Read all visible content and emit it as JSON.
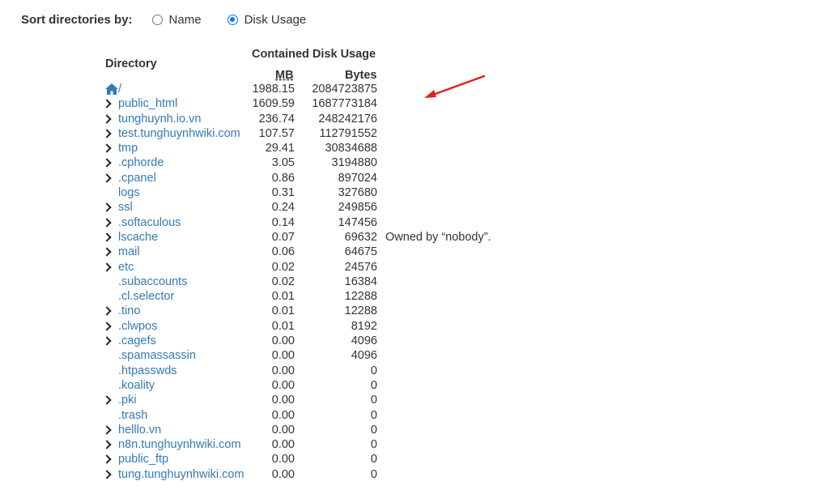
{
  "sort": {
    "label": "Sort directories by:",
    "options": [
      {
        "label": "Name",
        "checked": false
      },
      {
        "label": "Disk Usage",
        "checked": true
      }
    ]
  },
  "table": {
    "header_directory": "Directory",
    "header_contained": "Contained Disk Usage",
    "header_mb": "MB",
    "header_bytes": "Bytes"
  },
  "rows": [
    {
      "name": "/",
      "mb": "1988.15",
      "bytes": "2084723875",
      "expandable": false,
      "home": true,
      "note": ""
    },
    {
      "name": "public_html",
      "mb": "1609.59",
      "bytes": "1687773184",
      "expandable": true,
      "note": ""
    },
    {
      "name": "tunghuynh.io.vn",
      "mb": "236.74",
      "bytes": "248242176",
      "expandable": true,
      "note": ""
    },
    {
      "name": "test.tunghuynhwiki.com",
      "mb": "107.57",
      "bytes": "112791552",
      "expandable": true,
      "note": ""
    },
    {
      "name": "tmp",
      "mb": "29.41",
      "bytes": "30834688",
      "expandable": true,
      "note": ""
    },
    {
      "name": ".cphorde",
      "mb": "3.05",
      "bytes": "3194880",
      "expandable": true,
      "note": ""
    },
    {
      "name": ".cpanel",
      "mb": "0.86",
      "bytes": "897024",
      "expandable": true,
      "note": ""
    },
    {
      "name": "logs",
      "mb": "0.31",
      "bytes": "327680",
      "expandable": false,
      "note": ""
    },
    {
      "name": "ssl",
      "mb": "0.24",
      "bytes": "249856",
      "expandable": true,
      "note": ""
    },
    {
      "name": ".softaculous",
      "mb": "0.14",
      "bytes": "147456",
      "expandable": true,
      "note": ""
    },
    {
      "name": "lscache",
      "mb": "0.07",
      "bytes": "69632",
      "expandable": true,
      "note": "Owned by “nobody”."
    },
    {
      "name": "mail",
      "mb": "0.06",
      "bytes": "64675",
      "expandable": true,
      "note": ""
    },
    {
      "name": "etc",
      "mb": "0.02",
      "bytes": "24576",
      "expandable": true,
      "note": ""
    },
    {
      "name": ".subaccounts",
      "mb": "0.02",
      "bytes": "16384",
      "expandable": false,
      "note": ""
    },
    {
      "name": ".cl.selector",
      "mb": "0.01",
      "bytes": "12288",
      "expandable": false,
      "note": ""
    },
    {
      "name": ".tino",
      "mb": "0.01",
      "bytes": "12288",
      "expandable": true,
      "note": ""
    },
    {
      "name": ".clwpos",
      "mb": "0.01",
      "bytes": "8192",
      "expandable": true,
      "note": ""
    },
    {
      "name": ".cagefs",
      "mb": "0.00",
      "bytes": "4096",
      "expandable": true,
      "note": ""
    },
    {
      "name": ".spamassassin",
      "mb": "0.00",
      "bytes": "4096",
      "expandable": false,
      "note": ""
    },
    {
      "name": ".htpasswds",
      "mb": "0.00",
      "bytes": "0",
      "expandable": false,
      "note": ""
    },
    {
      "name": ".koality",
      "mb": "0.00",
      "bytes": "0",
      "expandable": false,
      "note": ""
    },
    {
      "name": ".pki",
      "mb": "0.00",
      "bytes": "0",
      "expandable": true,
      "note": ""
    },
    {
      "name": ".trash",
      "mb": "0.00",
      "bytes": "0",
      "expandable": false,
      "note": ""
    },
    {
      "name": "helllo.vn",
      "mb": "0.00",
      "bytes": "0",
      "expandable": true,
      "note": ""
    },
    {
      "name": "n8n.tunghuynhwiki.com",
      "mb": "0.00",
      "bytes": "0",
      "expandable": true,
      "note": ""
    },
    {
      "name": "public_ftp",
      "mb": "0.00",
      "bytes": "0",
      "expandable": true,
      "note": ""
    },
    {
      "name": "tung.tunghuynhwiki.com",
      "mb": "0.00",
      "bytes": "0",
      "expandable": true,
      "note": ""
    }
  ],
  "colors": {
    "link": "#337ab7",
    "radio_accent": "#0075ff",
    "annotation_arrow": "#e02020"
  },
  "icons": {
    "home": "home-icon",
    "expand": "chevron-right-icon",
    "annotation": "red-arrow-icon"
  }
}
